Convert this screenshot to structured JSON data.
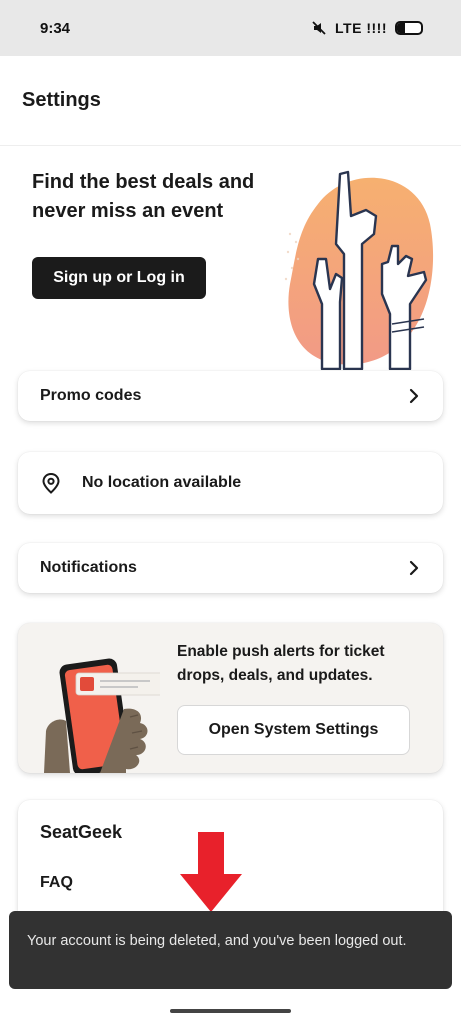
{
  "status_bar": {
    "time": "9:34",
    "network": "LTE !!!!",
    "battery_level": 0.35
  },
  "header": {
    "title": "Settings"
  },
  "hero": {
    "title": "Find the best deals and never miss an event",
    "signup_label": "Sign up or Log in"
  },
  "promo": {
    "label": "Promo codes"
  },
  "location": {
    "label": "No location available"
  },
  "notifications": {
    "label": "Notifications"
  },
  "push": {
    "text": "Enable push alerts for ticket drops, deals, and updates.",
    "button_label": "Open System Settings"
  },
  "seatgeek": {
    "title": "SeatGeek",
    "faq_label": "FAQ"
  },
  "snackbar": {
    "message": "Your account is being deleted, and you've been logged out."
  },
  "colors": {
    "accent_peach": "#f2a57a",
    "dark_button": "#1b1b1b",
    "arrow_red": "#e8212b",
    "snackbar_bg": "#323232"
  }
}
